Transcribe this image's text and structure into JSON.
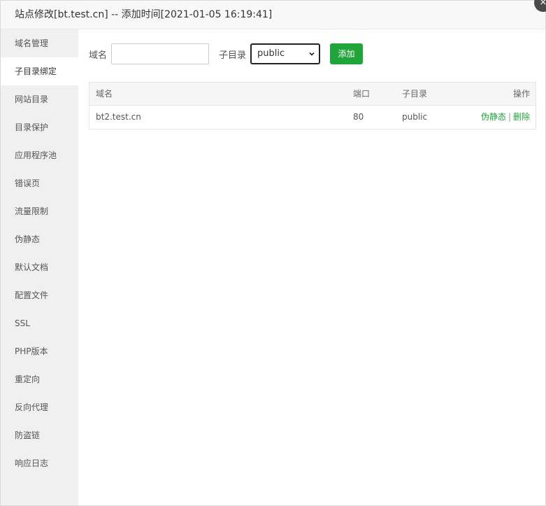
{
  "dialog": {
    "title": "站点修改[bt.test.cn] -- 添加时间[2021-01-05 16:19:41]",
    "close_glyph": "×"
  },
  "sidebar": {
    "items": [
      {
        "label": "域名管理",
        "active": false
      },
      {
        "label": "子目录绑定",
        "active": true
      },
      {
        "label": "网站目录",
        "active": false
      },
      {
        "label": "目录保护",
        "active": false
      },
      {
        "label": "应用程序池",
        "active": false
      },
      {
        "label": "错误页",
        "active": false
      },
      {
        "label": "流量限制",
        "active": false
      },
      {
        "label": "伪静态",
        "active": false
      },
      {
        "label": "默认文档",
        "active": false
      },
      {
        "label": "配置文件",
        "active": false
      },
      {
        "label": "SSL",
        "active": false
      },
      {
        "label": "PHP版本",
        "active": false
      },
      {
        "label": "重定向",
        "active": false
      },
      {
        "label": "反向代理",
        "active": false
      },
      {
        "label": "防盗链",
        "active": false
      },
      {
        "label": "响应日志",
        "active": false
      }
    ]
  },
  "form": {
    "domain_label": "域名",
    "domain_value": "",
    "subdir_label": "子目录",
    "subdir_selected": "public",
    "add_label": "添加"
  },
  "table": {
    "headers": {
      "domain": "域名",
      "port": "端口",
      "subdir": "子目录",
      "ops": "操作"
    },
    "rows": [
      {
        "domain": "bt2.test.cn",
        "port": "80",
        "subdir": "public",
        "op_rewrite": "伪静态",
        "op_sep": "|",
        "op_delete": "删除"
      }
    ]
  },
  "colors": {
    "accent": "#20a53a",
    "sidebar_bg": "#f0f0f0"
  }
}
